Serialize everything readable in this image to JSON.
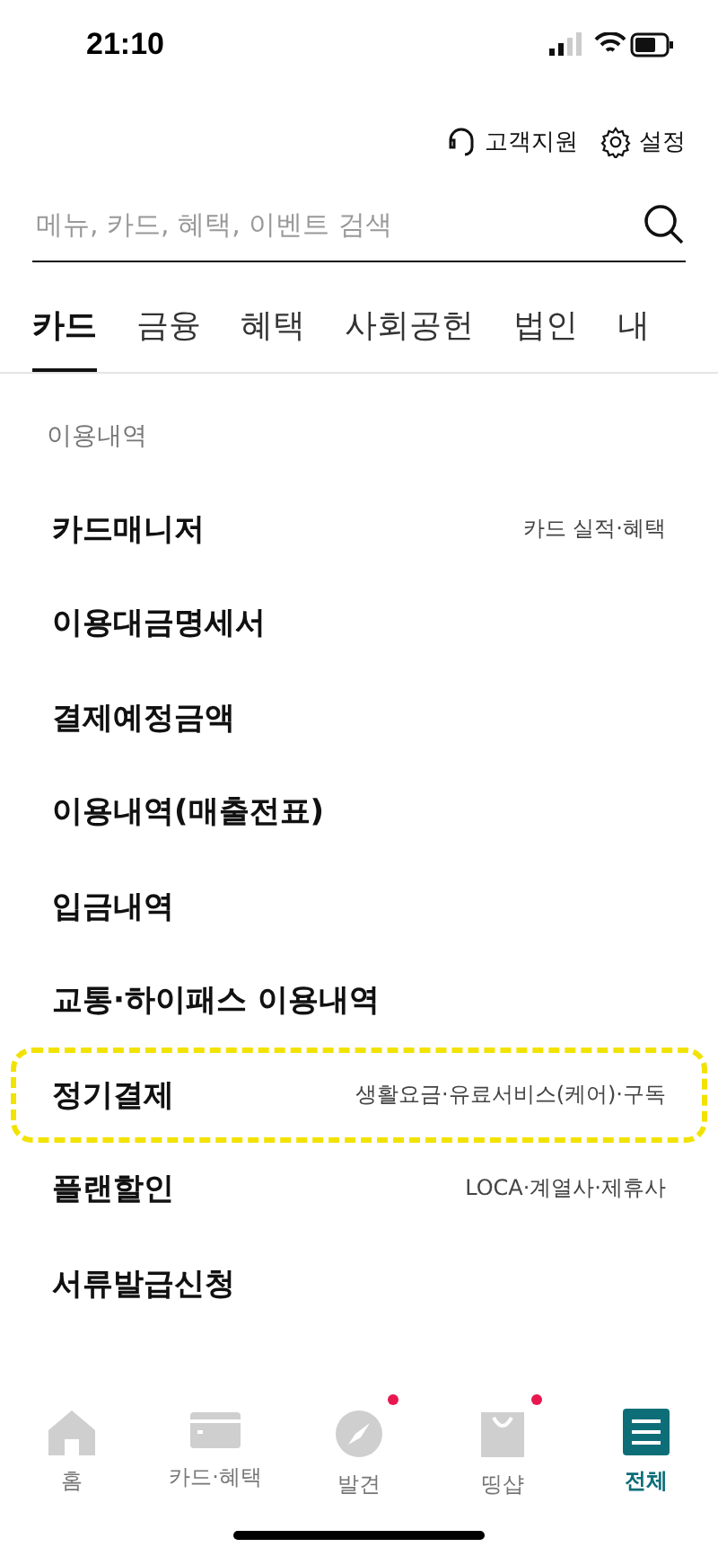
{
  "status_bar": {
    "time": "21:10"
  },
  "top_links": [
    {
      "label": "고객지원"
    },
    {
      "label": "설정"
    }
  ],
  "search": {
    "placeholder": "메뉴, 카드, 혜택, 이벤트 검색"
  },
  "tabs": [
    {
      "label": "카드",
      "selected": true
    },
    {
      "label": "금융",
      "selected": false
    },
    {
      "label": "혜택",
      "selected": false
    },
    {
      "label": "사회공헌",
      "selected": false
    },
    {
      "label": "법인",
      "selected": false
    },
    {
      "label": "내",
      "selected": false
    }
  ],
  "section": {
    "title": "이용내역",
    "items": [
      {
        "label": "카드매니저",
        "detail": "카드 실적·혜택",
        "highlighted": false
      },
      {
        "label": "이용대금명세서",
        "highlighted": false
      },
      {
        "label": "결제예정금액",
        "highlighted": false
      },
      {
        "label": "이용내역(매출전표)",
        "highlighted": false
      },
      {
        "label": "입금내역",
        "highlighted": false
      },
      {
        "label": "교통·하이패스 이용내역",
        "highlighted": false
      },
      {
        "label": "정기결제",
        "detail": "생활요금·유료서비스(케어)·구독",
        "highlighted": true
      },
      {
        "label": "플랜할인",
        "detail": "LOCA·계열사·제휴사",
        "highlighted": false
      },
      {
        "label": "서류발급신청",
        "highlighted": false
      }
    ]
  },
  "bottom_nav": [
    {
      "label": "홈",
      "selected": false,
      "dot": false
    },
    {
      "label": "카드·혜택",
      "selected": false,
      "dot": false
    },
    {
      "label": "발견",
      "selected": false,
      "dot": true
    },
    {
      "label": "띵샵",
      "selected": false,
      "dot": true
    },
    {
      "label": "전체",
      "selected": true,
      "dot": false
    }
  ]
}
